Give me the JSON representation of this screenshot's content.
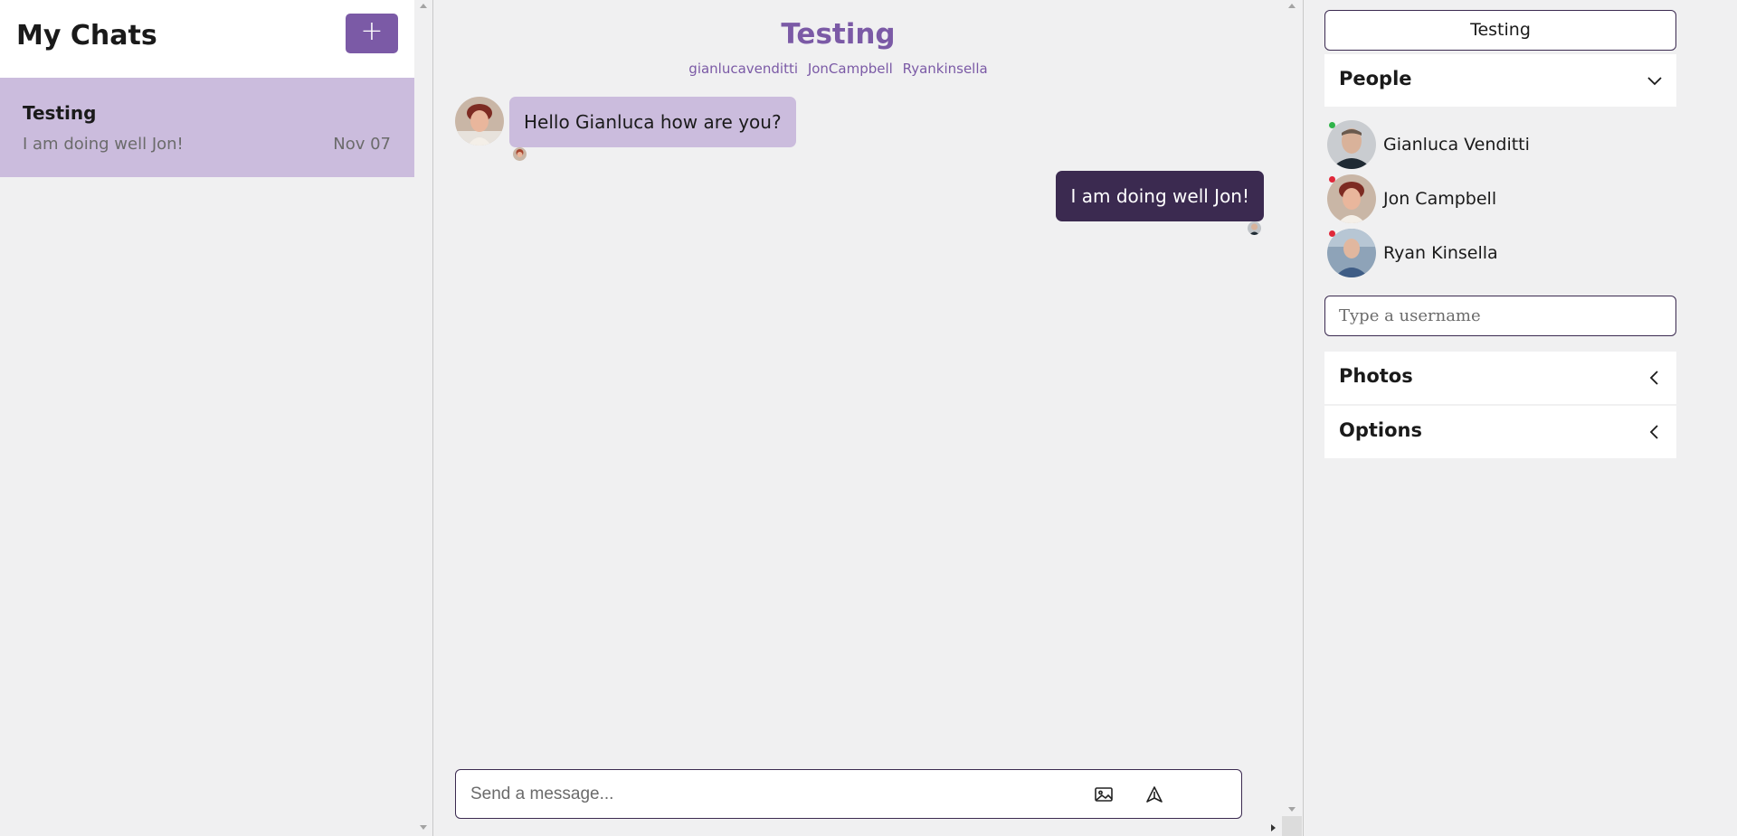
{
  "left": {
    "title": "My Chats",
    "add_button_label": "+",
    "chats": [
      {
        "title": "Testing",
        "preview": "I am doing well Jon!",
        "date": "Nov 07"
      }
    ]
  },
  "chat": {
    "title": "Testing",
    "members": [
      "gianlucavenditti",
      "JonCampbell",
      "Ryankinsella"
    ],
    "messages": [
      {
        "text": "Hello Gianluca how are you?",
        "direction": "incoming"
      },
      {
        "text": "I am doing well Jon!",
        "direction": "outgoing"
      }
    ],
    "composer_placeholder": "Send a message...",
    "icons": {
      "attach": "image-icon",
      "send": "send-icon"
    }
  },
  "settings": {
    "chat_title": "Testing",
    "people_label": "People",
    "people": [
      {
        "name": "Gianluca Venditti",
        "status": "online",
        "status_color": "#2fb34a"
      },
      {
        "name": "Jon Campbell",
        "status": "offline",
        "status_color": "#e0283a"
      },
      {
        "name": "Ryan Kinsella",
        "status": "offline",
        "status_color": "#e0283a"
      }
    ],
    "username_placeholder": "Type a username",
    "photos_label": "Photos",
    "options_label": "Options"
  },
  "colors": {
    "accent": "#7b5aa6",
    "accent_light": "#cbbcdd",
    "dark_bubble": "#3b2a50",
    "background": "#f0f0f1"
  }
}
